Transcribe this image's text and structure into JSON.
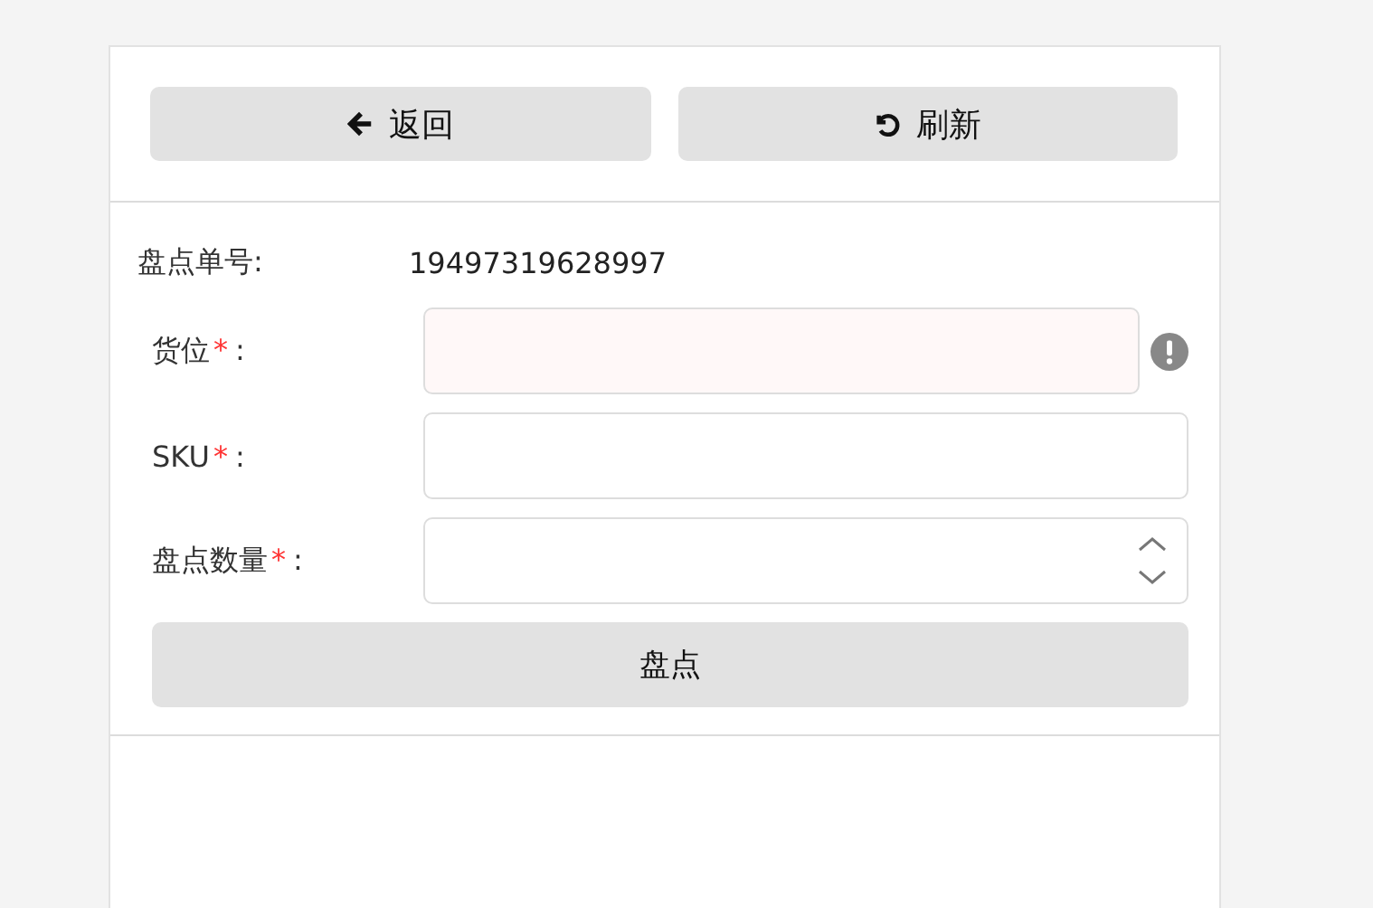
{
  "toolbar": {
    "buttons": [
      {
        "label": "返回",
        "kind": "back"
      },
      {
        "label": "刷新",
        "kind": "refresh"
      }
    ]
  },
  "order": {
    "label": "盘点单号:",
    "value": "19497319628997"
  },
  "fields": [
    {
      "kind": "text",
      "label": "货位",
      "required_mark": "*",
      "colon": ":",
      "invalid": true
    },
    {
      "kind": "text",
      "label": "SKU",
      "required_mark": "*",
      "colon": ":",
      "invalid": false
    },
    {
      "kind": "number",
      "label": "盘点数量",
      "required_mark": "*",
      "colon": ":",
      "invalid": false
    }
  ],
  "submit": {
    "label": "盘点"
  }
}
